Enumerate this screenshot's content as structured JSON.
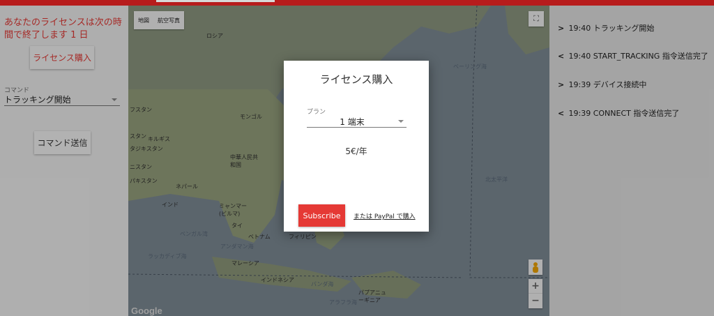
{
  "colors": {
    "accent": "#e53935",
    "topbar": "#b71c1c",
    "overlay": "rgba(0,0,0,0.28)"
  },
  "left_panel": {
    "license_message": "あなたのライセンスは次の時間で終了します 1 日",
    "buy_license_label": "ライセンス購入",
    "command_label": "コマンド",
    "command_value": "トラッキング開始",
    "send_command_label": "コマンド送信"
  },
  "map": {
    "type_buttons": [
      "地図",
      "航空写真"
    ],
    "fullscreen_icon": "fullscreen-icon",
    "zoom_in": "+",
    "zoom_out": "−",
    "logo": "Google",
    "labels": {
      "russia": "ロシア",
      "mongolia": "モンゴル",
      "kazakhstan": "フスタン",
      "uzbek": "スタン",
      "kyrgyz": "キルギス",
      "tajik": "タジキスタン",
      "afghan": "ニスタン",
      "pakistan": "パキスタン",
      "nepal": "ネパール",
      "china": "中華人民共和国",
      "india": "インド",
      "myanmar": "ミャンマー(ビルマ)",
      "thailand": "タイ",
      "vietnam": "ベトナム",
      "philippines": "フィリピン",
      "malaysia": "マレーシア",
      "indonesia": "インドネシア",
      "png": "パプアニューギニア",
      "bering": "ベーリング海",
      "north_pacific": "北太平洋",
      "bengal": "ベンガル湾",
      "andaman": "アンダマン海",
      "laccadive": "ラッカディブ海",
      "banda": "バンダ海",
      "arafura": "アラフラ海"
    }
  },
  "log": [
    {
      "chevron": ">",
      "time": "19:40",
      "text": "トラッキング開始"
    },
    {
      "chevron": "<",
      "time": "19:40",
      "text": "START_TRACKING 指令送信完了"
    },
    {
      "chevron": ">",
      "time": "19:39",
      "text": "デバイス接続中"
    },
    {
      "chevron": "<",
      "time": "19:39",
      "text": "CONNECT 指令送信完了"
    }
  ],
  "dialog": {
    "title": "ライセンス購入",
    "plan_label": "プラン",
    "plan_value": "1 端末",
    "price": "5€/年",
    "subscribe_label": "Subscribe",
    "paypal_label": "または PayPal で購入"
  }
}
